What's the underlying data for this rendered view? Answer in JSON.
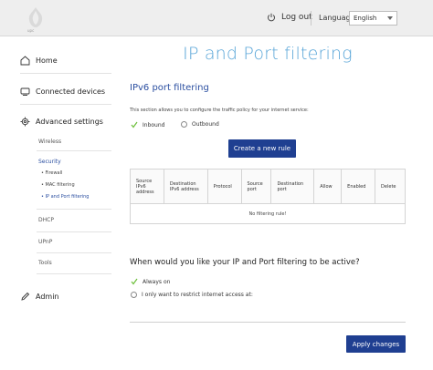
{
  "header": {
    "logo_text": "upc",
    "logout_label": "Log out",
    "language_label": "Language",
    "language_value": "English"
  },
  "sidebar": {
    "home": "Home",
    "connected_devices": "Connected devices",
    "advanced_settings": "Advanced settings",
    "wireless": "Wireless",
    "security": "Security",
    "firewall": "• Firewall",
    "mac_filtering": "• MAC filtering",
    "ip_port_filtering": "• IP and Port filtering",
    "dhcp": "DHCP",
    "upnp": "UPnP",
    "tools": "Tools",
    "admin": "Admin"
  },
  "main": {
    "page_title": "IP and Port filtering",
    "section_title": "IPv6 port filtering",
    "description": "This section allows you to configure the traffic policy for your internet service:",
    "inbound_label": "Inbound",
    "outbound_label": "Outbound",
    "create_rule_button": "Create a new rule",
    "table_headers": [
      "Source IPv6 address",
      "Destination IPv6 address",
      "Protocol",
      "Source port",
      "Destination port",
      "Allow",
      "Enabled",
      "Delete"
    ],
    "empty_message": "No filtering rule!",
    "question": "When would you like your IP and Port filtering to be active?",
    "always_on_label": "Always on",
    "restrict_label": "I only want to restrict internet access at:",
    "apply_button": "Apply changes"
  },
  "colors": {
    "accent": "#2a4ea0",
    "button": "#1f3f91",
    "title": "#5aa6d8",
    "check_green": "#6cbf3a"
  }
}
